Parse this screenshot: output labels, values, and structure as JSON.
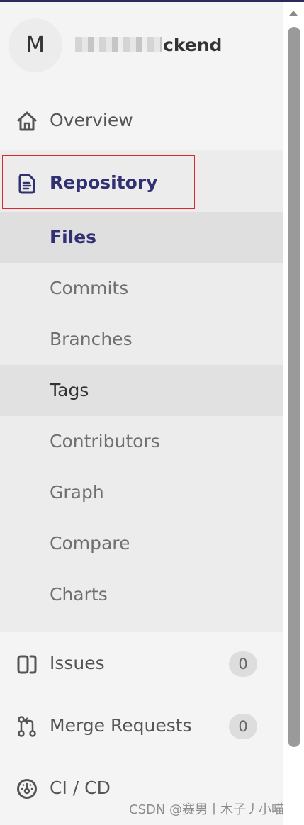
{
  "project": {
    "avatar_letter": "M",
    "name_visible": "ckend"
  },
  "nav": {
    "overview": {
      "label": "Overview",
      "icon": "home-icon"
    },
    "repository": {
      "label": "Repository",
      "icon": "document-icon",
      "items": [
        {
          "label": "Files",
          "state": "active"
        },
        {
          "label": "Commits",
          "state": "normal"
        },
        {
          "label": "Branches",
          "state": "normal"
        },
        {
          "label": "Tags",
          "state": "hover"
        },
        {
          "label": "Contributors",
          "state": "normal"
        },
        {
          "label": "Graph",
          "state": "normal"
        },
        {
          "label": "Compare",
          "state": "normal"
        },
        {
          "label": "Charts",
          "state": "normal"
        }
      ]
    },
    "issues": {
      "label": "Issues",
      "count": "0",
      "icon": "issues-icon"
    },
    "merge_requests": {
      "label": "Merge Requests",
      "count": "0",
      "icon": "merge-request-icon"
    },
    "cicd": {
      "label": "CI / CD",
      "icon": "rocket-gauge-icon"
    }
  },
  "watermark": "CSDN @赛男丨木子丿小喵",
  "colors": {
    "active_text": "#303073",
    "highlight_border": "#d9272e",
    "sidebar_bg": "#f4f4f4",
    "section_bg": "#ececec"
  }
}
